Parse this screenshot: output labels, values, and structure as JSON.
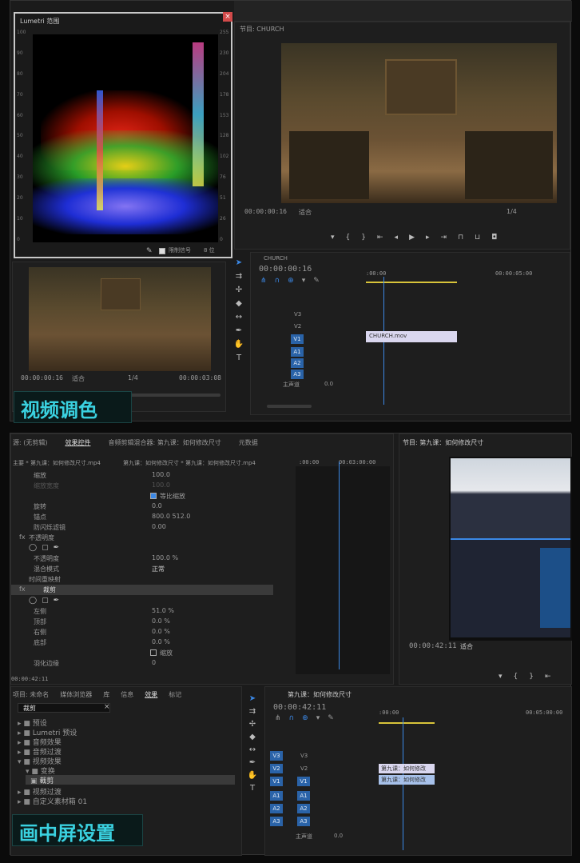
{
  "top": {
    "scope_title": "Lumetri 范围",
    "scale_left": [
      "100",
      "90",
      "80",
      "70",
      "60",
      "50",
      "40",
      "30",
      "20",
      "10",
      "0"
    ],
    "scale_right": [
      "255",
      "230",
      "204",
      "178",
      "153",
      "128",
      "102",
      "76",
      "51",
      "26",
      "0"
    ],
    "scope_bottom_check": "限制信号",
    "scope_bottom_val": "8 位",
    "program_tab": "节目: CHURCH",
    "program_time": "00:00:00:16",
    "program_fit": "适合",
    "program_res": "1/4",
    "source_time": "00:00:00:16",
    "source_fit": "适合",
    "source_res": "1/4",
    "source_duration": "00:00:03:08",
    "seq_tab": "CHURCH",
    "seq_time": "00:00:00:16",
    "ruler_start": ":00:00",
    "ruler_end": "00:00:05:00",
    "video_tracks": [
      "V3",
      "V2",
      "V1"
    ],
    "audio_tracks": [
      "A1",
      "A2",
      "A3"
    ],
    "master_label": "主声道",
    "master_val": "0.0",
    "clip_name": "CHURCH.mov",
    "caption": "视频调色"
  },
  "bottom": {
    "tabs": [
      "源: (无剪辑)",
      "效果控件",
      "音频剪辑混合器: 第九课：如何修改尺寸",
      "元数据"
    ],
    "ec_header_left": "主要 * 第九课：如何修改尺寸.mp4",
    "ec_header_right": "第九课：如何修改尺寸 * 第九课：如何修改尺寸.mp4",
    "ec_ruler_start": ":00:00",
    "ec_ruler_end": "00:03:00:00",
    "props": [
      {
        "label": "缩放",
        "value": "100.0"
      },
      {
        "label": "缩放宽度",
        "value": "100.0"
      },
      {
        "label": "",
        "value": "等比缩放"
      },
      {
        "label": "旋转",
        "value": "0.0"
      },
      {
        "label": "锚点",
        "value": "800.0     512.0"
      },
      {
        "label": "防闪烁滤镜",
        "value": "0.00"
      },
      {
        "label": "不透明度",
        "value": ""
      },
      {
        "label": "不透明度",
        "value": "100.0 %"
      },
      {
        "label": "混合模式",
        "value": "正常"
      },
      {
        "label": "时间重映射",
        "value": ""
      },
      {
        "label": "裁剪",
        "value": ""
      },
      {
        "label": "左侧",
        "value": "51.0 %"
      },
      {
        "label": "顶部",
        "value": "0.0 %"
      },
      {
        "label": "右侧",
        "value": "0.0 %"
      },
      {
        "label": "底部",
        "value": "0.0 %"
      },
      {
        "label": "",
        "value": "缩放"
      },
      {
        "label": "羽化边缘",
        "value": "0"
      }
    ],
    "ec_footer_time": "00:00:42:11",
    "program_tab": "节目: 第九课：如何修改尺寸",
    "program_time": "00:00:42:11",
    "program_fit": "适合",
    "proj_tabs": [
      "项目: 未命名",
      "媒体浏览器",
      "库",
      "信息",
      "效果",
      "标记"
    ],
    "search_value": "裁剪",
    "tree": [
      "预设",
      "Lumetri 预设",
      "音频效果",
      "音频过渡",
      "视频效果",
      "变换",
      "裁剪",
      "视频过渡",
      "自定义素材箱 01"
    ],
    "seq_tab": "第九课：如何修改尺寸",
    "seq_time": "00:00:42:11",
    "ruler_start": ":00:00",
    "ruler_end": "00:05:00:00",
    "video_tracks": [
      "V3",
      "V2",
      "V1"
    ],
    "audio_tracks": [
      "A1",
      "A2",
      "A3"
    ],
    "master_label": "主声道",
    "master_val": "0.0",
    "clip1": "第九课：如何修改",
    "clip2": "第九课：如何修改",
    "caption": "画中屏设置"
  }
}
